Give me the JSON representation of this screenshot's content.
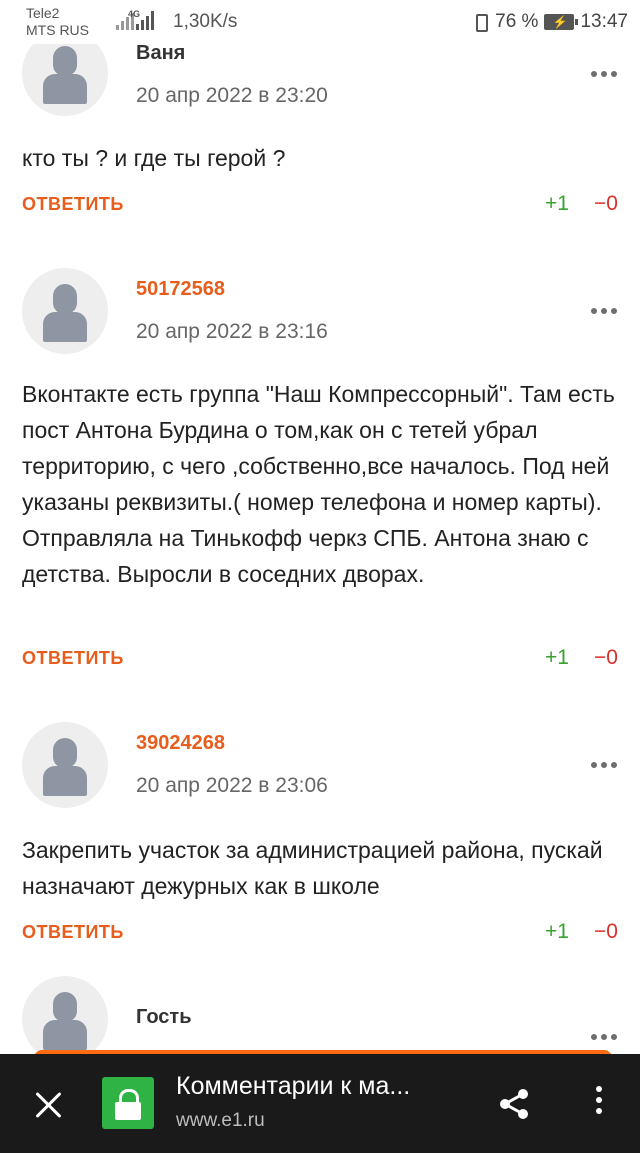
{
  "status_bar": {
    "carrier1": "Tele2",
    "carrier2": "MTS RUS",
    "net_type": "4G",
    "speed": "1,30K/s",
    "battery_percent": "76 %",
    "time": "13:47"
  },
  "comments": [
    {
      "author": "Ваня",
      "date": "20 апр 2022 в 23:20",
      "text": "кто ты ? и где ты герой ?",
      "reply_label": "ОТВЕТИТЬ",
      "plus": "+1",
      "minus": "−0"
    },
    {
      "author": "50172568",
      "date": "20 апр 2022 в 23:16",
      "text": "Вконтакте есть группа \"Наш Компрессорный\". Там есть пост Антона Бурдина о том,как он с тетей убрал территорию, с чего ,собственно,все началось. Под ней указаны реквизиты.( номер телефона и номер карты). Отправляла на Тинькофф черкз СПБ. Антона знаю с детства. Выросли в соседних дворах.",
      "reply_label": "ОТВЕТИТЬ",
      "plus": "+1",
      "minus": "−0"
    },
    {
      "author": "39024268",
      "date": "20 апр 2022 в 23:06",
      "text": "Закрепить участок за администрацией района, пускай назначают дежурных как в школе",
      "reply_label": "ОТВЕТИТЬ",
      "plus": "+1",
      "minus": "−0"
    },
    {
      "author": "Гость"
    }
  ],
  "bottom_bar": {
    "title": "Комментарии к ма...",
    "url": "www.e1.ru",
    "icons": [
      "close-icon",
      "lock-icon",
      "share-icon",
      "more-vertical-icon"
    ]
  },
  "colors": {
    "accent_orange": "#e65d1c",
    "plus_green": "#3aa12e",
    "minus_red": "#d9302c",
    "bar_bg": "#1a1a1a"
  }
}
